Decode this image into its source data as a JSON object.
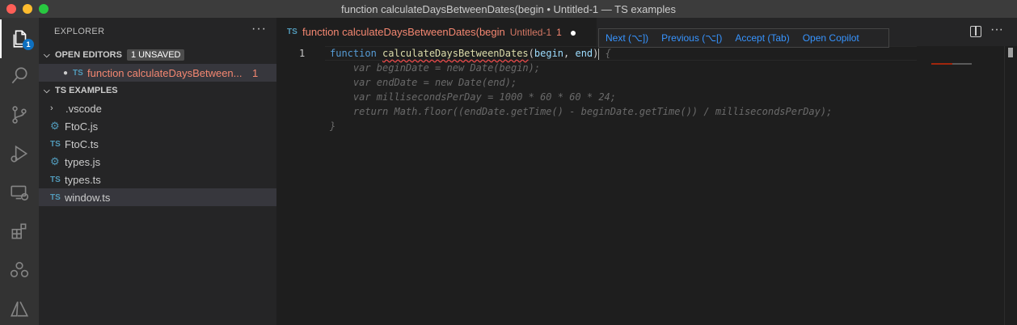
{
  "window": {
    "title": "function calculateDaysBetweenDates(begin • Untitled-1 — TS examples"
  },
  "activity_bar": {
    "icons": [
      "explorer-icon",
      "search-icon",
      "source-control-icon",
      "run-debug-icon",
      "remote-explorer-icon",
      "extensions-icon",
      "accounts-group-icon",
      "azure-icon"
    ],
    "explorer_badge": "1"
  },
  "sidebar": {
    "title": "EXPLORER",
    "more": "···",
    "open_editors": {
      "label": "OPEN EDITORS",
      "badge": "1 UNSAVED",
      "items": [
        {
          "type": "TS",
          "name": "function calculateDaysBetween...",
          "problems": "1"
        }
      ]
    },
    "workspace": {
      "label": "TS EXAMPLES",
      "items": [
        {
          "kind": "folder",
          "name": ".vscode"
        },
        {
          "kind": "js",
          "name": "FtoC.js"
        },
        {
          "kind": "ts",
          "name": "FtoC.ts",
          "tag": "TS"
        },
        {
          "kind": "js",
          "name": "types.js"
        },
        {
          "kind": "ts",
          "name": "types.ts",
          "tag": "TS"
        },
        {
          "kind": "ts",
          "name": "window.ts",
          "tag": "TS"
        }
      ]
    }
  },
  "editor": {
    "tab": {
      "tag": "TS",
      "name": "function calculateDaysBetweenDates(begin",
      "description": "Untitled-1",
      "problems": "1",
      "dirty": "●"
    },
    "copilot_bar": {
      "next": "Next (⌥])",
      "previous": "Previous (⌥[)",
      "accept": "Accept (Tab)",
      "open": "Open Copilot"
    },
    "more": "···",
    "line_number": "1",
    "code": {
      "kw_function": "function",
      "fn_name": "calculateDaysBetweenDates",
      "open_paren": "(",
      "param1": "begin",
      "comma": ", ",
      "param2": "end",
      "close_paren": ")",
      "ghost_brace": " {",
      "ghost_lines": [
        "    var beginDate = new Date(begin);",
        "    var endDate = new Date(end);",
        "    var millisecondsPerDay = 1000 * 60 * 60 * 24;",
        "    return Math.floor((endDate.getTime() - beginDate.getTime()) / millisecondsPerDay);",
        "}"
      ]
    }
  },
  "colors": {
    "accent": "#3794ff",
    "error": "#f48771",
    "keyword": "#569cd6",
    "function": "#dcdcaa",
    "parameter": "#9cdcfe",
    "ghost_text": "#6a6a6a"
  }
}
